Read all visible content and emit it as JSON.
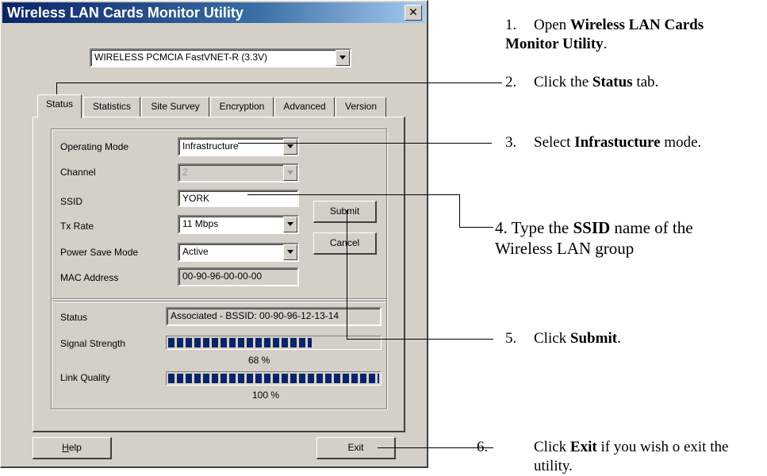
{
  "window": {
    "title": "Wireless LAN Cards Monitor Utility",
    "close_glyph": "✕"
  },
  "adapter": {
    "selected": "WIRELESS PCMCIA FastVNET-R (3.3V)"
  },
  "tabs": [
    "Status",
    "Statistics",
    "Site Survey",
    "Encryption",
    "Advanced",
    "Version"
  ],
  "active_tab": "Status",
  "config": {
    "operating_mode": {
      "label": "Operating Mode",
      "value": "Infrastructure"
    },
    "channel": {
      "label": "Channel",
      "value": "2"
    },
    "ssid": {
      "label": "SSID",
      "value": "YORK"
    },
    "tx_rate": {
      "label": "Tx Rate",
      "value": "11 Mbps"
    },
    "power_save": {
      "label": "Power Save Mode",
      "value": "Active"
    },
    "mac": {
      "label": "MAC Address",
      "value": "00-90-96-00-00-00"
    }
  },
  "buttons": {
    "submit": "Submit",
    "cancel": "Cancel",
    "help": "Help",
    "exit": "Exit"
  },
  "status": {
    "status_label": "Status",
    "status_value": "Associated - BSSID: 00-90-96-12-13-14",
    "signal_label": "Signal Strength",
    "signal_percent": 68,
    "signal_text": "68 %",
    "link_label": "Link Quality",
    "link_percent": 100,
    "link_text": "100 %"
  },
  "steps": [
    {
      "num": "1.",
      "pre": "Open ",
      "bold": "Wireless LAN Cards Monitor Utility",
      "post": "."
    },
    {
      "num": "2.",
      "pre": "Click the ",
      "bold": "Status",
      "post": " tab."
    },
    {
      "num": "3.",
      "pre": "Select ",
      "bold": "Infrastucture",
      "post": " mode."
    },
    {
      "num": "4.",
      "pre": "Type the ",
      "bold": "SSID",
      "post": " name of the Wireless LAN group"
    },
    {
      "num": "5.",
      "pre": "Click ",
      "bold": "Submit",
      "post": "."
    },
    {
      "num": "6.",
      "pre": "Click ",
      "bold": "Exit",
      "post": " if you wish o exit the utility."
    }
  ],
  "colors": {
    "titlebar": "#0a246a",
    "dialog_bg": "#d4d0c8",
    "meter_fill": "#0a246a"
  }
}
